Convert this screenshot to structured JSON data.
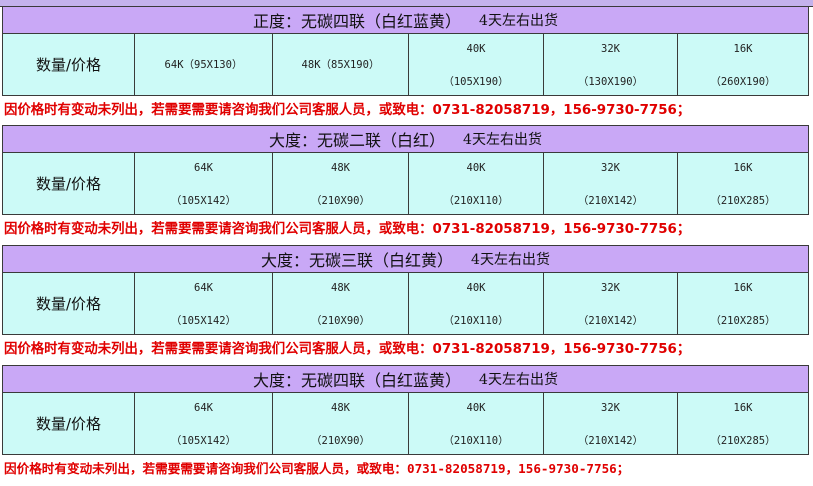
{
  "label": "数量/价格",
  "note": "因价格时有变动未列出，若需要需要请咨询我们公司客服人员，或致电：0731-82058719，156-9730-7756；",
  "sections": [
    {
      "title": "正度：无碳四联（白红蓝黄）",
      "ship": "4天左右出货",
      "cells": [
        {
          "k": "64K（95X130）"
        },
        {
          "k": "48K（85X190）"
        },
        {
          "k": "40K",
          "s": "（105X190）"
        },
        {
          "k": "32K",
          "s": "（130X190）"
        },
        {
          "k": "16K",
          "s": "（260X190）"
        }
      ]
    },
    {
      "title": "大度：无碳二联（白红）",
      "ship": "4天左右出货",
      "cells": [
        {
          "k": "64K",
          "s": "（105X142）"
        },
        {
          "k": "48K",
          "s": "（210X90）"
        },
        {
          "k": "40K",
          "s": "（210X110）"
        },
        {
          "k": "32K",
          "s": "（210X142）"
        },
        {
          "k": "16K",
          "s": "（210X285）"
        }
      ]
    },
    {
      "title": "大度：无碳三联（白红黄）",
      "ship": "4天左右出货",
      "cells": [
        {
          "k": "64K",
          "s": "（105X142）"
        },
        {
          "k": "48K",
          "s": "（210X90）"
        },
        {
          "k": "40K",
          "s": "（210X110）"
        },
        {
          "k": "32K",
          "s": "（210X142）"
        },
        {
          "k": "16K",
          "s": "（210X285）"
        }
      ]
    },
    {
      "title": "大度：无碳四联（白红蓝黄）",
      "ship": "4天左右出货",
      "cells": [
        {
          "k": "64K",
          "s": "（105X142）"
        },
        {
          "k": "48K",
          "s": "（210X90）"
        },
        {
          "k": "40K",
          "s": "（210X110）"
        },
        {
          "k": "32K",
          "s": "（210X142）"
        },
        {
          "k": "16K",
          "s": "（210X285）"
        }
      ]
    }
  ]
}
